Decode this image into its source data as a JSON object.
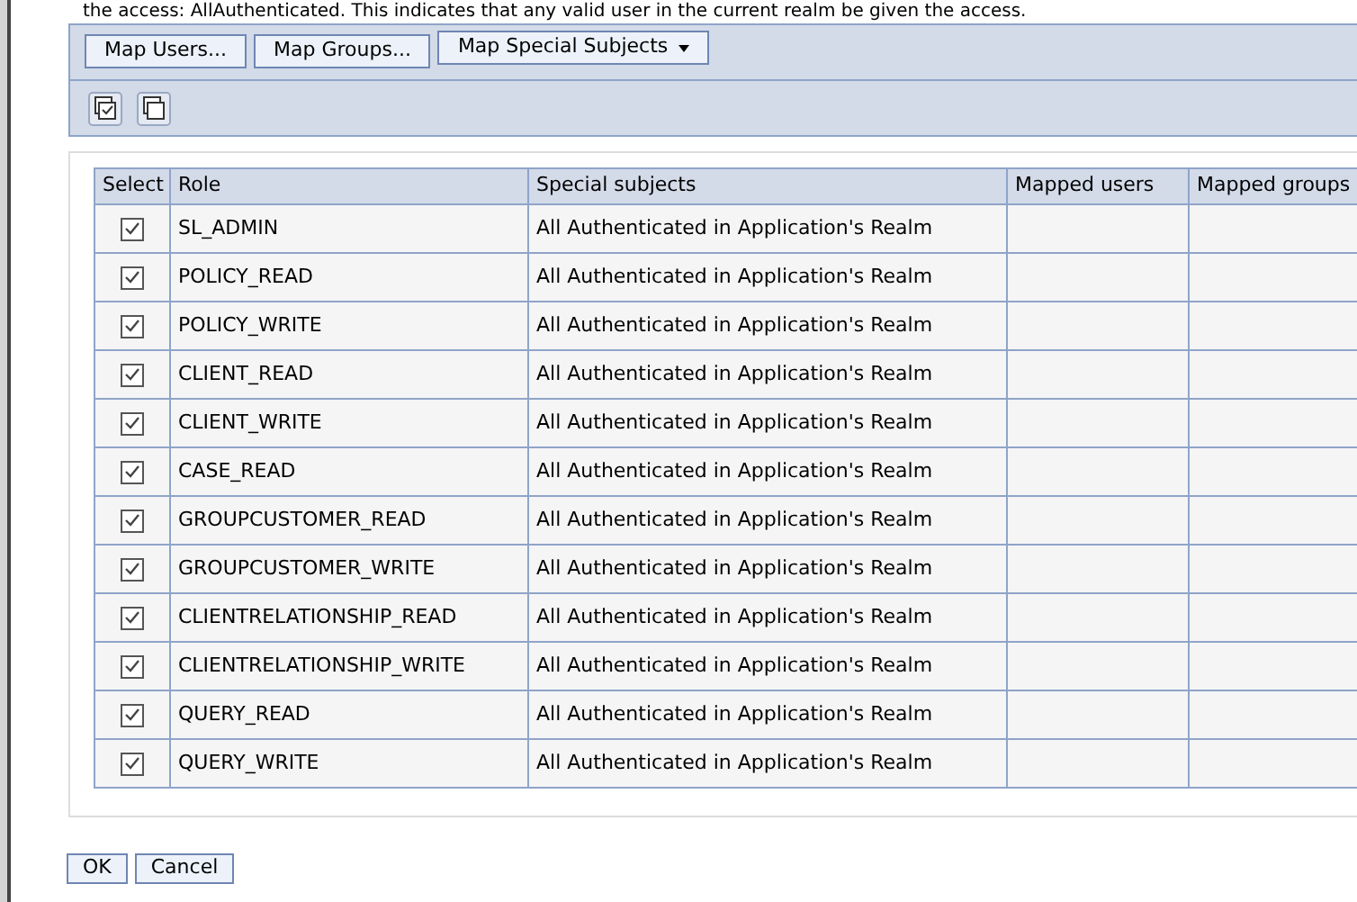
{
  "intro_text": "the access: AllAuthenticated. This indicates that any valid user in the current realm be given the access.",
  "map_buttons": [
    {
      "label": "Map Users...",
      "kind": "plain"
    },
    {
      "label": "Map Groups...",
      "kind": "plain"
    },
    {
      "label": "Map Special Subjects",
      "kind": "dropdown"
    }
  ],
  "table": {
    "columns": [
      "Select",
      "Role",
      "Special subjects",
      "Mapped users",
      "Mapped groups"
    ],
    "rows": [
      {
        "checked": true,
        "role": "SL_ADMIN",
        "special_subjects": "All Authenticated in Application's Realm"
      },
      {
        "checked": true,
        "role": "POLICY_READ",
        "special_subjects": "All Authenticated in Application's Realm"
      },
      {
        "checked": true,
        "role": "POLICY_WRITE",
        "special_subjects": "All Authenticated in Application's Realm"
      },
      {
        "checked": true,
        "role": "CLIENT_READ",
        "special_subjects": "All Authenticated in Application's Realm"
      },
      {
        "checked": true,
        "role": "CLIENT_WRITE",
        "special_subjects": "All Authenticated in Application's Realm"
      },
      {
        "checked": true,
        "role": "CASE_READ",
        "special_subjects": "All Authenticated in Application's Realm"
      },
      {
        "checked": true,
        "role": "GROUPCUSTOMER_READ",
        "special_subjects": "All Authenticated in Application's Realm"
      },
      {
        "checked": true,
        "role": "GROUPCUSTOMER_WRITE",
        "special_subjects": "All Authenticated in Application's Realm"
      },
      {
        "checked": true,
        "role": "CLIENTRELATIONSHIP_READ",
        "special_subjects": "All Authenticated in Application's Realm"
      },
      {
        "checked": true,
        "role": "CLIENTRELATIONSHIP_WRITE",
        "special_subjects": "All Authenticated in Application's Realm"
      },
      {
        "checked": true,
        "role": "QUERY_READ",
        "special_subjects": "All Authenticated in Application's Realm"
      },
      {
        "checked": true,
        "role": "QUERY_WRITE",
        "special_subjects": "All Authenticated in Application's Realm"
      }
    ]
  },
  "footer_buttons": [
    "OK",
    "Cancel"
  ]
}
